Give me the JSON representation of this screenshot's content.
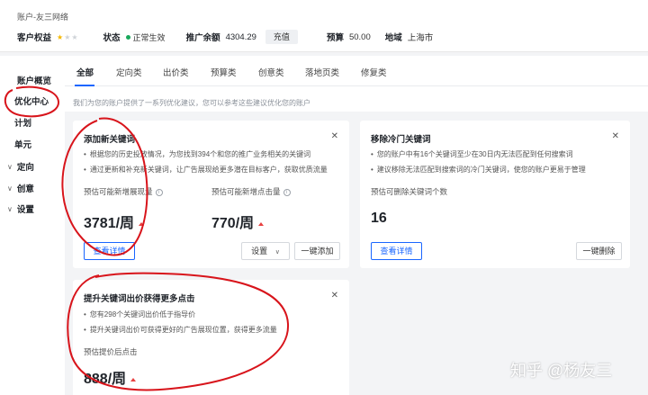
{
  "header": {
    "breadcrumb": "账户-友三网络",
    "rights_label": "客户权益",
    "rating_stars": 1,
    "rating_max": 3,
    "status_label": "状态",
    "status_value": "正常生效",
    "status_color": "#19a85b",
    "balance_label": "推广余额",
    "balance_value": "4304.29",
    "recharge_label": "充值",
    "budget_label": "预算",
    "budget_value": "50.00",
    "region_label": "地域",
    "region_value": "上海市"
  },
  "sidebar": {
    "items": [
      {
        "label": "账户概览",
        "expandable": false,
        "active": false
      },
      {
        "label": "优化中心",
        "expandable": false,
        "active": true
      },
      {
        "label": "计划",
        "expandable": false,
        "active": false
      },
      {
        "label": "单元",
        "expandable": false,
        "active": false
      },
      {
        "label": "定向",
        "expandable": true,
        "active": false
      },
      {
        "label": "创意",
        "expandable": true,
        "active": false
      },
      {
        "label": "设置",
        "expandable": true,
        "active": false
      }
    ]
  },
  "tabs": [
    "全部",
    "定向类",
    "出价类",
    "预算类",
    "创意类",
    "落地页类",
    "修复类"
  ],
  "active_tab": "全部",
  "hint": "我们为您的账户提供了一系列优化建议，您可以参考这些建议优化您的账户",
  "cards": {
    "add_keywords": {
      "title": "添加新关键词",
      "bullets": [
        "根据您的历史投放情况，为您找到394个和您的推广业务相关的关键词",
        "通过更新和补充新关键词，让广告展现给更多潜在目标客户，获取优质流量"
      ],
      "metric1_label": "预估可能新增展现量",
      "metric1_value": "3781/周",
      "metric2_label": "预估可能新增点击量",
      "metric2_value": "770/周",
      "details_label": "查看详情",
      "settings_label": "设置",
      "add_all_label": "一键添加"
    },
    "remove_cold": {
      "title": "移除冷门关键词",
      "bullets": [
        "您的账户中有16个关键词至少在30日内无法匹配到任何搜索词",
        "建议移除无法匹配到搜索词的冷门关键词，使您的账户更易于管理"
      ],
      "metric_label": "预估可删除关键词个数",
      "metric_value": "16",
      "details_label": "查看详情",
      "remove_all_label": "一键删除"
    },
    "raise_bid": {
      "title": "提升关键词出价获得更多点击",
      "bullets": [
        "您有298个关键词出价低于指导价",
        "提升关键词出价可获得更好的广告展现位置，获得更多流量"
      ],
      "metric_label": "预估提价后点击",
      "metric_value": "888/周"
    }
  },
  "watermark": "知乎 @杨友三",
  "colors": {
    "accent": "#1a66ff",
    "annotation_red": "#d8141b",
    "trend_up": "#e84040"
  }
}
